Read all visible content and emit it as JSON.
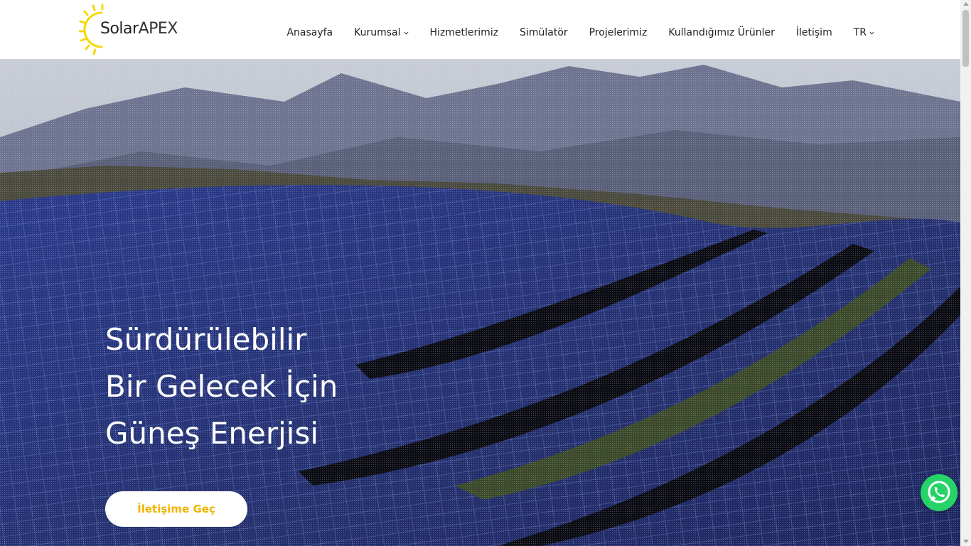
{
  "brand": {
    "logo_text_solar": "Solar",
    "logo_text_apex": "APEX",
    "sun_color": "#f5d800"
  },
  "nav": {
    "items": [
      {
        "label": "Anasayfa",
        "has_dropdown": false
      },
      {
        "label": "Kurumsal",
        "has_dropdown": true
      },
      {
        "label": "Hizmetlerimiz",
        "has_dropdown": false
      },
      {
        "label": "Simülatör",
        "has_dropdown": false
      },
      {
        "label": "Projelerimiz",
        "has_dropdown": false
      },
      {
        "label": "Kullandığımız Ürünler",
        "has_dropdown": false
      },
      {
        "label": "İletişim",
        "has_dropdown": false
      },
      {
        "label": "TR",
        "has_dropdown": true
      }
    ]
  },
  "hero": {
    "title_lines": [
      "Sürdürülebilir",
      "Bir Gelecek İçin",
      "Güneş Enerjisi"
    ],
    "cta_label": "İletişime Geç",
    "cta_color": "#f0b400",
    "background": "solar-panel-field-mountains"
  },
  "floating": {
    "whatsapp_icon": "whatsapp-icon",
    "whatsapp_color": "#25d366"
  }
}
